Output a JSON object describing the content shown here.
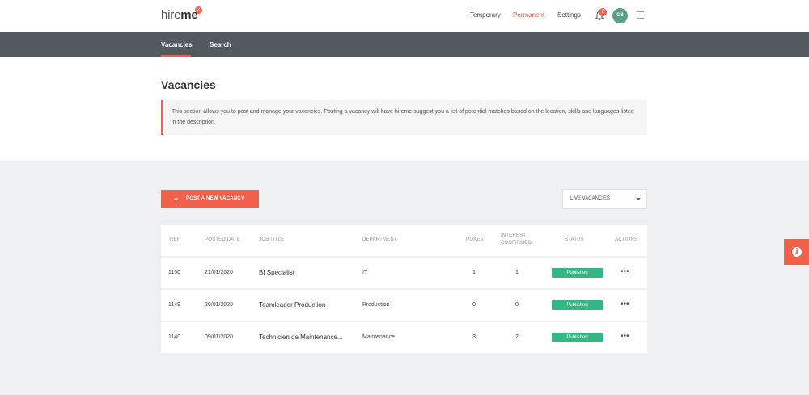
{
  "header": {
    "logo_hire": "hire",
    "logo_me": "me",
    "nav": [
      {
        "label": "Temporary"
      },
      {
        "label": "Permanent"
      },
      {
        "label": "Settings"
      }
    ],
    "notification_count": "6",
    "avatar_initials": "CB"
  },
  "subnav": {
    "tabs": [
      {
        "label": "Vacancies"
      },
      {
        "label": "Search"
      }
    ]
  },
  "page": {
    "title": "Vacancies",
    "info": "This section allows you to post and manage your vacancies. Posting a vacancy will have hireme suggest you a list of potential matches based on the location, skills and languages listed in the description."
  },
  "toolbar": {
    "post_label": "POST A NEW VACANCY",
    "filter_value": "LIVE VACANCIES"
  },
  "table": {
    "headers": {
      "ref": "REF",
      "posted": "POSTED DATE",
      "title": "JOB TITLE",
      "department": "DEPARTMENT",
      "pokes": "POKES",
      "interest1": "INTEREST",
      "interest2": "CONFIRMED",
      "status": "STATUS",
      "actions": "ACTIONS"
    },
    "rows": [
      {
        "ref": "1150",
        "posted": "21/01/2020",
        "title": "BI Specialist",
        "department": "IT",
        "pokes": "1",
        "interest": "1",
        "status": "Published",
        "actions": "•••"
      },
      {
        "ref": "1149",
        "posted": "20/01/2020",
        "title": "Teamleader Production",
        "department": "Production",
        "pokes": "0",
        "interest": "0",
        "status": "Published",
        "actions": "•••"
      },
      {
        "ref": "1140",
        "posted": "09/01/2020",
        "title": "Technicien de Maintenance...",
        "department": "Maintenance",
        "pokes": "3",
        "interest": "2",
        "status": "Published",
        "actions": "•••"
      }
    ]
  },
  "side_info_icon": "i"
}
